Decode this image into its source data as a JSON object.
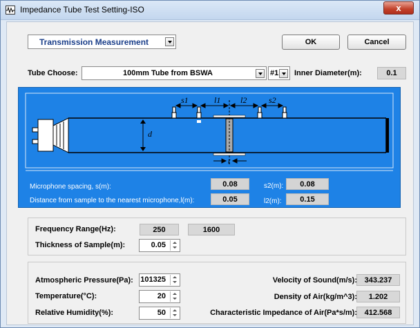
{
  "window": {
    "title": "Impedance Tube Test Setting-ISO",
    "close_label": "x"
  },
  "top": {
    "mode": "Transmission Measurement",
    "ok_label": "OK",
    "cancel_label": "Cancel"
  },
  "tube": {
    "label": "Tube Choose:",
    "value": "100mm Tube from BSWA",
    "number": "#1",
    "inner_diameter_label": "Inner Diameter(m):",
    "inner_diameter": "0.1"
  },
  "diagram": {
    "s1": "s1",
    "l1": "l1",
    "l2": "l2",
    "s2": "s2",
    "d": "d",
    "t": "t",
    "mic_spacing_label": "Microphone spacing, s(m):",
    "s1_value": "0.08",
    "s2_label": "s2(m):",
    "s2_value": "0.08",
    "distance_label": "Distance from sample to the nearest microphone,l(m):",
    "l1_value": "0.05",
    "l2_label": "l2(m):",
    "l2_value": "0.15"
  },
  "sample": {
    "freq_label": "Frequency Range(Hz):",
    "freq_low": "250",
    "freq_high": "1600",
    "thickness_label": "Thickness of Sample(m):",
    "thickness": "0.05"
  },
  "environment": {
    "pressure_label": "Atmospheric Pressure(Pa):",
    "pressure": "101325",
    "temperature_label": "Temperature(°C):",
    "temperature": "20",
    "humidity_label": "Relative Humidity(%):",
    "humidity": "50",
    "velocity_label": "Velocity of Sound(m/s):",
    "velocity": "343.237",
    "density_label": "Density of Air(kg/m^3):",
    "density": "1.202",
    "impedance_label": "Characteristic Impedance of Air(Pa*s/m):",
    "impedance": "412.568"
  }
}
